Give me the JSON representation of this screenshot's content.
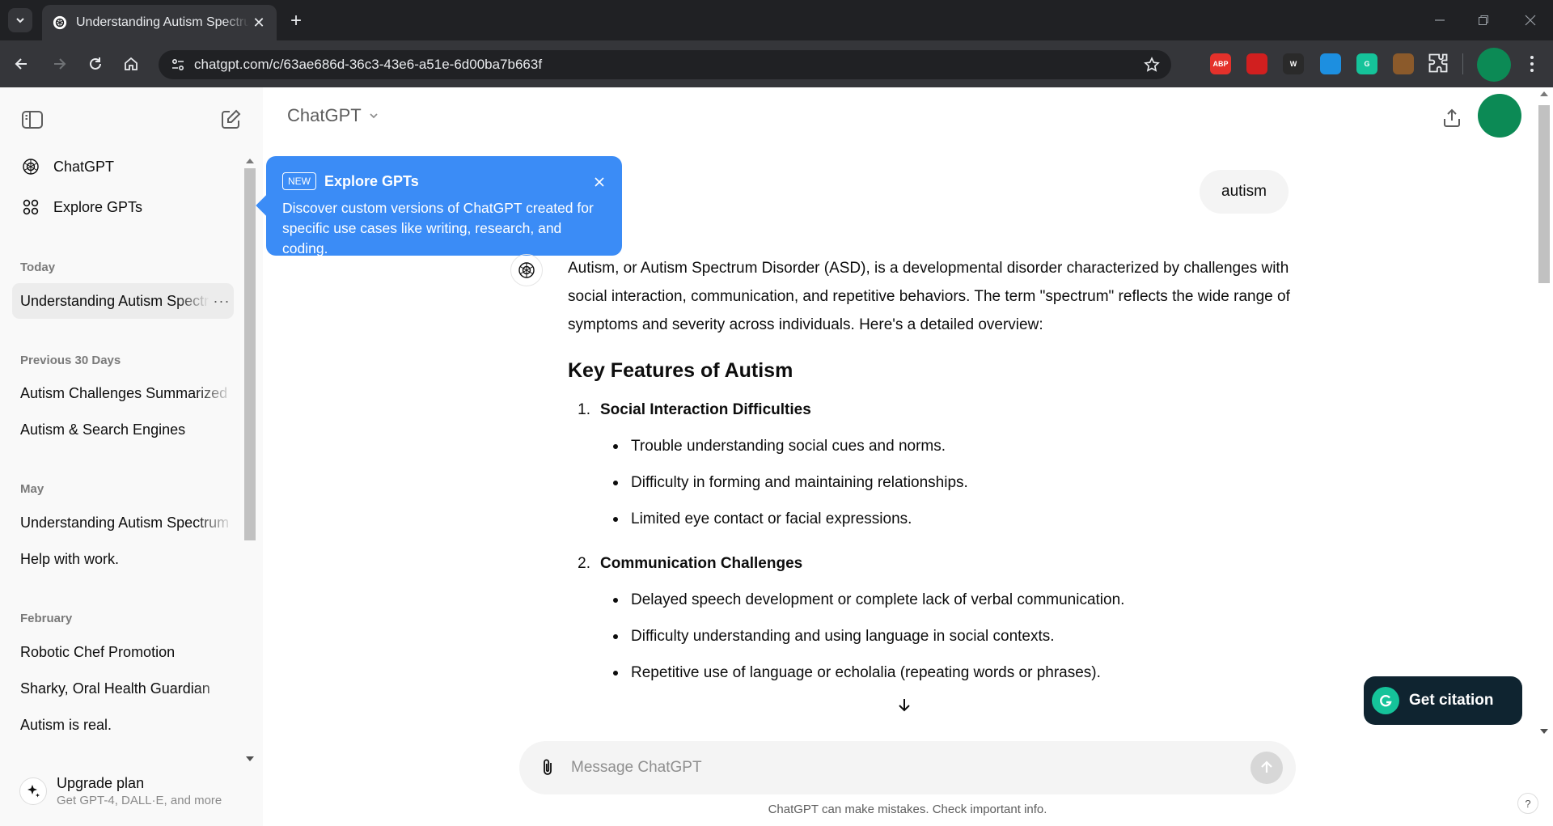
{
  "browser": {
    "tab_title": "Understanding Autism Spectrum Disorder",
    "new_tab_symbol": "+",
    "close_symbol": "✕",
    "url": "chatgpt.com/c/63ae686d-36c3-43e6-a51e-6d00ba7b663f",
    "extensions": [
      {
        "name": "adblock-plus-icon",
        "label": "ABP",
        "color": "#e4312b"
      },
      {
        "name": "stop-hand-extension-icon",
        "label": "",
        "color": "#d11f1f"
      },
      {
        "name": "w-extension-icon",
        "label": "W",
        "color": "#2a2a2a"
      },
      {
        "name": "blue-extension-icon",
        "label": "",
        "color": "#1d8fe0"
      },
      {
        "name": "grammarly-extension-icon",
        "label": "G",
        "color": "#15c39a"
      },
      {
        "name": "brown-extension-icon",
        "label": "",
        "color": "#8b5a2b"
      }
    ]
  },
  "sidebar": {
    "nav": [
      {
        "label": "ChatGPT",
        "icon": "openai-logo-icon"
      },
      {
        "label": "Explore GPTs",
        "icon": "grid-icon"
      }
    ],
    "groups": [
      {
        "title": "Today",
        "items": [
          {
            "label": "Understanding Autism Spectrum Disorder",
            "active": true
          }
        ]
      },
      {
        "title": "Previous 30 Days",
        "items": [
          {
            "label": "Autism Challenges Summarized"
          },
          {
            "label": "Autism & Search Engines"
          }
        ]
      },
      {
        "title": "May",
        "items": [
          {
            "label": "Understanding Autism Spectrum"
          },
          {
            "label": "Help with work."
          }
        ]
      },
      {
        "title": "February",
        "items": [
          {
            "label": "Robotic Chef Promotion"
          },
          {
            "label": "Sharky, Oral Health Guardian"
          },
          {
            "label": "Autism is real."
          }
        ]
      }
    ],
    "more_symbol": "···",
    "upgrade": {
      "title": "Upgrade plan",
      "subtitle": "Get GPT-4, DALL·E, and more"
    }
  },
  "header": {
    "model": "ChatGPT"
  },
  "popup": {
    "badge": "NEW",
    "title": "Explore GPTs",
    "body": "Discover custom versions of ChatGPT created for specific use cases like writing, research, and coding."
  },
  "conversation": {
    "user_message": "autism",
    "intro": "Autism, or Autism Spectrum Disorder (ASD), is a developmental disorder characterized by challenges with social interaction, communication, and repetitive behaviors. The term \"spectrum\" reflects the wide range of symptoms and severity across individuals. Here's a detailed overview:",
    "heading": "Key Features of Autism",
    "sections": [
      {
        "num": "1.",
        "title": "Social Interaction Difficulties",
        "bullets": [
          "Trouble understanding social cues and norms.",
          "Difficulty in forming and maintaining relationships.",
          "Limited eye contact or facial expressions."
        ]
      },
      {
        "num": "2.",
        "title": "Communication Challenges",
        "bullets": [
          "Delayed speech development or complete lack of verbal communication.",
          "Difficulty understanding and using language in social contexts.",
          "Repetitive use of language or echolalia (repeating words or phrases)."
        ]
      }
    ]
  },
  "citation": {
    "label": "Get citation"
  },
  "composer": {
    "placeholder": "Message ChatGPT"
  },
  "footer": {
    "disclaimer": "ChatGPT can make mistakes. Check important info.",
    "help": "?"
  }
}
